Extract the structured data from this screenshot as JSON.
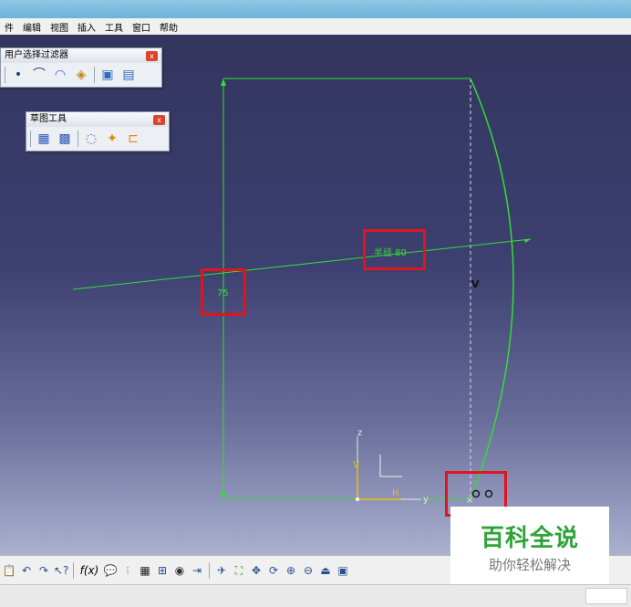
{
  "menubar": {
    "items": [
      "件",
      "编辑",
      "视图",
      "插入",
      "工具",
      "窗口",
      "帮助"
    ]
  },
  "toolbox_filter": {
    "title": "用户选择过滤器",
    "close": "x",
    "icons": [
      "point-filter-icon",
      "curve-filter-icon",
      "surface-filter-icon",
      "volume-filter-icon",
      "feature-filter-icon",
      "intersection-filter-icon"
    ]
  },
  "toolbox_sketch": {
    "title": "草图工具",
    "close": "x",
    "icons": [
      "grid-icon",
      "snap-to-point-icon",
      "construction-element-icon",
      "geometric-constraint-icon",
      "dimensional-constraint-icon"
    ]
  },
  "sketch": {
    "dim_radius": "半径 80",
    "dim_length": "75",
    "constraint_v": "V",
    "axis_h": "H",
    "axis_v": "V",
    "axis_y": "y",
    "axis_z": "z",
    "line_color": "#33dd33",
    "highlight_color": "#e0141c"
  },
  "bottom_toolbar": {
    "icons": [
      "paste-icon",
      "undo-icon",
      "redo-icon",
      "whats-this-icon",
      "formula-icon",
      "knowledge-icon",
      "separator",
      "table-icon",
      "tree-icon",
      "camera-icon",
      "swap-icon",
      "fit-all-icon",
      "pan-icon",
      "rotate-icon",
      "zoom-in-icon",
      "zoom-out-icon",
      "normal-view-icon",
      "views-icon"
    ],
    "formula_label": "f(x)"
  },
  "watermark": {
    "main": "百科全说",
    "sub": "助你轻松解决"
  }
}
